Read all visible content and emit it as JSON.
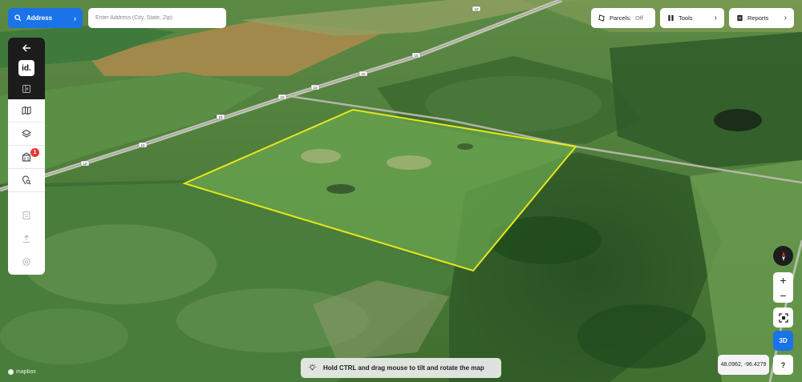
{
  "search": {
    "button_label": "Address",
    "placeholder": "Enter Address (City, State, Zip)",
    "value": ""
  },
  "toolbar": {
    "parcels_label": "Parcels:",
    "parcels_state": "Off",
    "tools_label": "Tools",
    "reports_label": "Reports"
  },
  "sidebar": {
    "logo_text": "id.",
    "layers_badge": "1",
    "items": [
      {
        "icon": "arrow-left-icon"
      },
      {
        "icon": "logo-icon"
      },
      {
        "icon": "panel-collapse-icon"
      },
      {
        "icon": "map-icon"
      },
      {
        "icon": "layers-icon"
      },
      {
        "icon": "buildings-icon"
      },
      {
        "icon": "location-search-icon"
      },
      {
        "icon": "document-icon"
      },
      {
        "icon": "upload-icon"
      },
      {
        "icon": "settings-icon"
      }
    ]
  },
  "map": {
    "road_labels": [
      "10",
      "10",
      "10",
      "10",
      "10",
      "10",
      "10",
      "10"
    ],
    "boundary_color": "#e6e61c",
    "attribution": "mapbox"
  },
  "controls": {
    "zoom_in": "+",
    "zoom_out": "−",
    "mode_3d": "3D",
    "help": "?",
    "coordinates": "48.0962, -96.4279"
  },
  "hint": {
    "text": "Hold CTRL and drag mouse to tilt and rotate the map"
  },
  "colors": {
    "accent": "#1a73e8",
    "badge": "#e53935"
  }
}
